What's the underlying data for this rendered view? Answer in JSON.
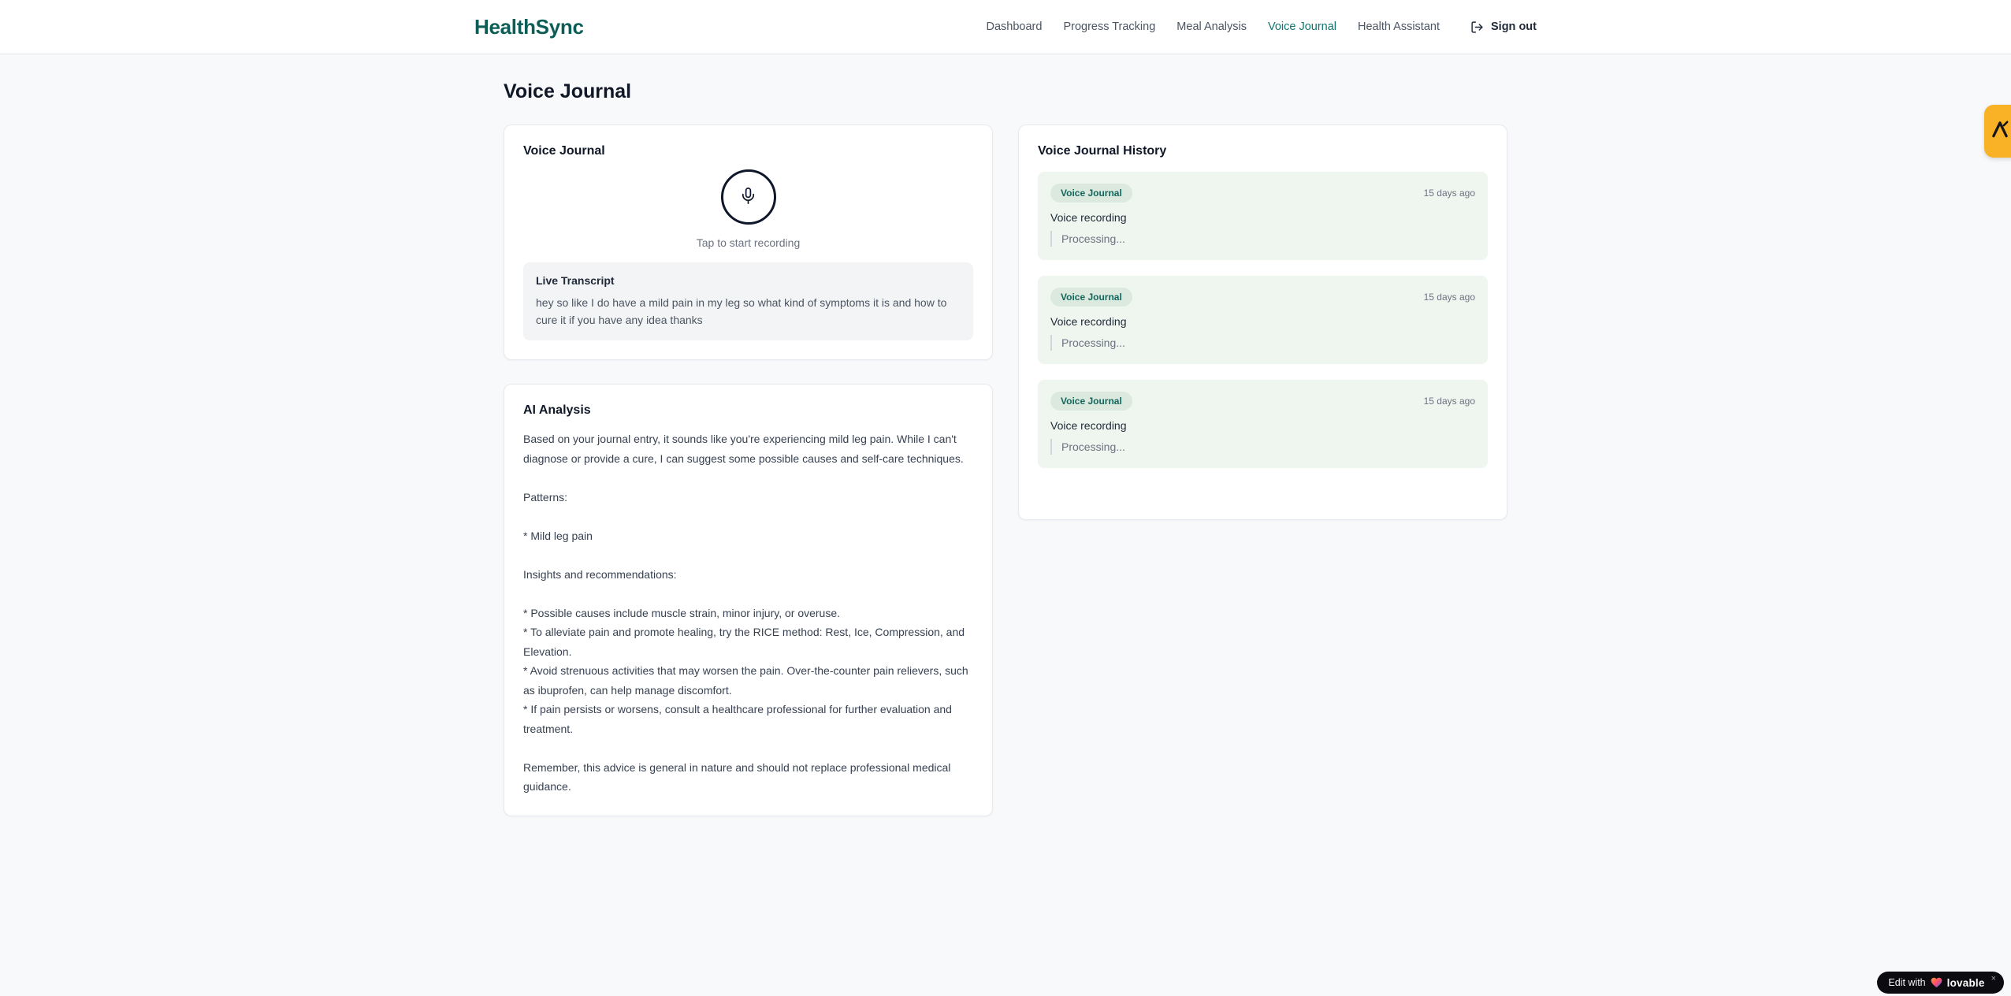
{
  "brand": {
    "name": "HealthSync"
  },
  "nav": {
    "items": [
      {
        "label": "Dashboard",
        "active": false
      },
      {
        "label": "Progress Tracking",
        "active": false
      },
      {
        "label": "Meal Analysis",
        "active": false
      },
      {
        "label": "Voice Journal",
        "active": true
      },
      {
        "label": "Health Assistant",
        "active": false
      }
    ],
    "sign_out_label": "Sign out"
  },
  "page": {
    "title": "Voice Journal"
  },
  "recorder_card": {
    "title": "Voice Journal",
    "tap_hint": "Tap to start recording",
    "transcript_title": "Live Transcript",
    "transcript_text": "hey so like I do have a mild pain in my leg so what kind of symptoms it is and how to cure it if you have any idea thanks"
  },
  "analysis_card": {
    "title": "AI Analysis",
    "body": "Based on your journal entry, it sounds like you're experiencing mild leg pain. While I can't diagnose or provide a cure, I can suggest some possible causes and self-care techniques.\n\nPatterns:\n\n* Mild leg pain\n\nInsights and recommendations:\n\n* Possible causes include muscle strain, minor injury, or overuse.\n* To alleviate pain and promote healing, try the RICE method: Rest, Ice, Compression, and Elevation.\n* Avoid strenuous activities that may worsen the pain. Over-the-counter pain relievers, such as ibuprofen, can help manage discomfort.\n* If pain persists or worsens, consult a healthcare professional for further evaluation and treatment.\n\nRemember, this advice is general in nature and should not replace professional medical guidance."
  },
  "history_card": {
    "title": "Voice Journal History",
    "items": [
      {
        "badge": "Voice Journal",
        "time": "15 days ago",
        "title": "Voice recording",
        "status": "Processing..."
      },
      {
        "badge": "Voice Journal",
        "time": "15 days ago",
        "title": "Voice recording",
        "status": "Processing..."
      },
      {
        "badge": "Voice Journal",
        "time": "15 days ago",
        "title": "Voice recording",
        "status": "Processing..."
      }
    ]
  },
  "lovable_badge": {
    "prefix": "Edit with",
    "brand": "lovable",
    "close": "×"
  },
  "colors": {
    "brand_teal": "#0b5d55",
    "nav_active": "#0f766e",
    "page_background": "#f8f9fb",
    "card_border": "#e7e9ee",
    "history_item_background": "#eef6ef",
    "badge_background": "#dbe9df",
    "badge_text": "#14655c",
    "amber_widget": "#f9b125",
    "lovable_background": "#0c0c10"
  }
}
